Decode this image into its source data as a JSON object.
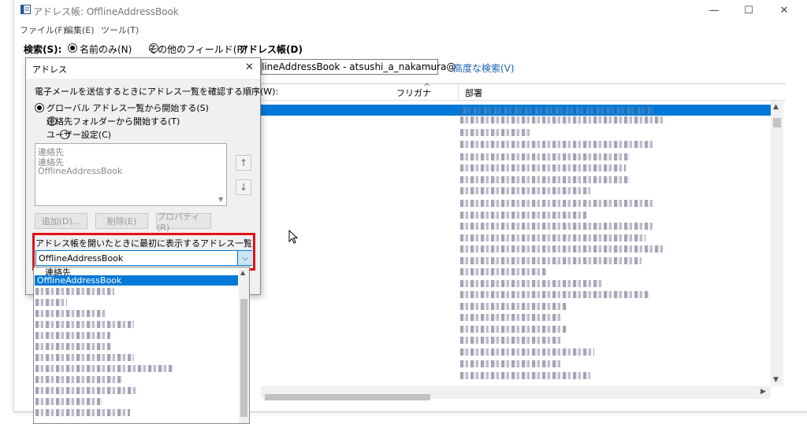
{
  "window": {
    "title": "アドレス帳: OfflineAddressBook",
    "minimize": "—",
    "maximize": "☐",
    "close": "✕"
  },
  "menu": [
    "ファイル(F)",
    "編集(E)",
    "ツール(T)"
  ],
  "search": {
    "label": "検索(S):",
    "option_name_only": "名前のみ(N)",
    "option_other_fields": "その他のフィールド(R)",
    "addressbook_label": "アドレス帳(D)",
    "addressbook_value": "lineAddressBook - atsushi_a_nakamura@",
    "advanced_link": "高度な検索(V)"
  },
  "list": {
    "columns": [
      "フリガナ",
      "部署"
    ],
    "sort_indicator": "^"
  },
  "dialog": {
    "title": "アドレス",
    "close": "✕",
    "order_label": "電子メールを送信するときにアドレス一覧を確認する順序(W):",
    "radio_global": "グローバル アドレス一覧から開始する(S)",
    "radio_contacts": "連絡先フォルダーから開始する(T)",
    "radio_custom": "ユーザー設定(C)",
    "list_items": [
      "連絡先",
      "連絡先",
      "OfflineAddressBook"
    ],
    "btn_add": "追加(D)...",
    "btn_delete": "削除(E)",
    "btn_properties": "プロパティ(R)",
    "up_arrow": "↑",
    "down_arrow": "↓",
    "first_show_label": "アドレス帳を開いたときに最初に表示するアドレス一覧:",
    "first_show_value": "OfflineAddressBook",
    "combo_arrow": "⌵"
  },
  "dropdown": {
    "partial_item": "連絡先",
    "selected_item": "OfflineAddressBook"
  },
  "colors": {
    "selection": "#0078d7",
    "highlight_box": "#e0121a",
    "link": "#1a5fb4"
  }
}
